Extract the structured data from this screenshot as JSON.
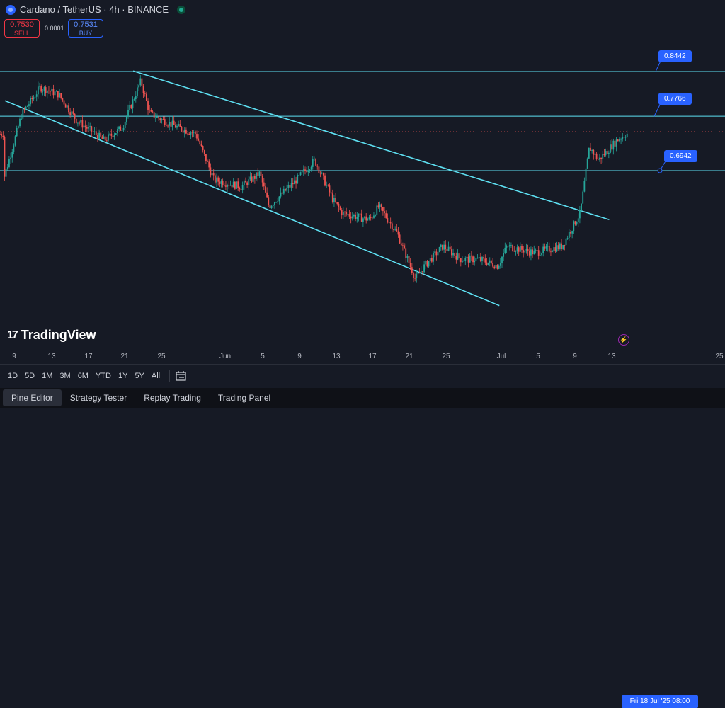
{
  "header": {
    "symbol": "Cardano / TetherUS · 4h · BINANCE",
    "sell_price": "0.7530",
    "sell_label": "SELL",
    "spread": "0.0001",
    "buy_price": "0.7531",
    "buy_label": "BUY"
  },
  "levels": [
    {
      "label": "0.8442",
      "value": 0.8442
    },
    {
      "label": "0.7766",
      "value": 0.7766
    },
    {
      "label": "0.6942",
      "value": 0.6942
    }
  ],
  "brand": "TradingView",
  "time_axis": {
    "ticks": [
      "9",
      "13",
      "17",
      "21",
      "25",
      "Jun",
      "5",
      "9",
      "13",
      "17",
      "21",
      "25",
      "Jul",
      "5",
      "9",
      "13",
      "25"
    ],
    "cursor_date": "Fri 18 Jul '25   08:00"
  },
  "ranges": [
    "1D",
    "5D",
    "1M",
    "3M",
    "6M",
    "YTD",
    "1Y",
    "5Y",
    "All"
  ],
  "bottom_tabs": [
    "Pine Editor",
    "Strategy Tester",
    "Replay Trading",
    "Trading Panel"
  ],
  "colors": {
    "up": "#26a69a",
    "down": "#ef5350",
    "line": "#5ee0f2",
    "accent": "#2962ff",
    "background": "#161a25"
  },
  "chart_data": {
    "type": "candlestick",
    "symbol": "ADAUSDT",
    "interval": "4h",
    "horizontal_levels": [
      0.8442,
      0.7766,
      0.6942
    ],
    "trend_channel": {
      "upper": [
        {
          "x": "May 22",
          "y": 0.845
        },
        {
          "x": "Jul 13",
          "y": 0.62
        }
      ],
      "lower": [
        {
          "x": "May 8",
          "y": 0.8
        },
        {
          "x": "Jul 1",
          "y": 0.49
        }
      ]
    },
    "price_path": [
      {
        "x": "May 8",
        "y": 0.68
      },
      {
        "x": "May 10",
        "y": 0.78
      },
      {
        "x": "May 12",
        "y": 0.82
      },
      {
        "x": "May 14",
        "y": 0.81
      },
      {
        "x": "May 16",
        "y": 0.77
      },
      {
        "x": "May 19",
        "y": 0.74
      },
      {
        "x": "May 21",
        "y": 0.76
      },
      {
        "x": "May 23",
        "y": 0.83
      },
      {
        "x": "May 24",
        "y": 0.78
      },
      {
        "x": "May 27",
        "y": 0.76
      },
      {
        "x": "May 29",
        "y": 0.75
      },
      {
        "x": "May 31",
        "y": 0.68
      },
      {
        "x": "Jun 3",
        "y": 0.67
      },
      {
        "x": "Jun 5",
        "y": 0.69
      },
      {
        "x": "Jun 6",
        "y": 0.64
      },
      {
        "x": "Jun 9",
        "y": 0.68
      },
      {
        "x": "Jun 11",
        "y": 0.71
      },
      {
        "x": "Jun 13",
        "y": 0.65
      },
      {
        "x": "Jun 14",
        "y": 0.63
      },
      {
        "x": "Jun 17",
        "y": 0.62
      },
      {
        "x": "Jun 18",
        "y": 0.64
      },
      {
        "x": "Jun 20",
        "y": 0.6
      },
      {
        "x": "Jun 22",
        "y": 0.53
      },
      {
        "x": "Jun 23",
        "y": 0.55
      },
      {
        "x": "Jun 25",
        "y": 0.58
      },
      {
        "x": "Jun 27",
        "y": 0.56
      },
      {
        "x": "Jun 29",
        "y": 0.56
      },
      {
        "x": "Jul 1",
        "y": 0.55
      },
      {
        "x": "Jul 2",
        "y": 0.58
      },
      {
        "x": "Jul 5",
        "y": 0.57
      },
      {
        "x": "Jul 8",
        "y": 0.58
      },
      {
        "x": "Jul 10",
        "y": 0.63
      },
      {
        "x": "Jul 11",
        "y": 0.73
      },
      {
        "x": "Jul 12",
        "y": 0.71
      },
      {
        "x": "Jul 14",
        "y": 0.74
      },
      {
        "x": "Jul 15",
        "y": 0.75
      }
    ],
    "last_price": 0.753
  }
}
